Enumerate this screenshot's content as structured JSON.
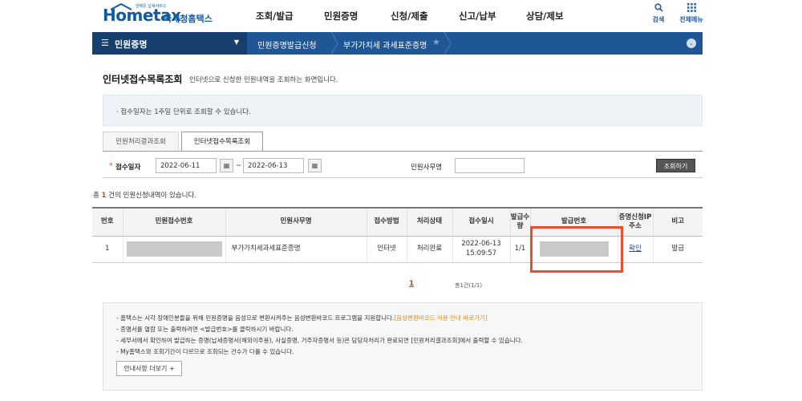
{
  "header": {
    "logo_text": "Hometax",
    "logo_tagline": "언제든 납세서비스",
    "logo_kr": "국세청홈택스",
    "menu": [
      "조회/발급",
      "민원증명",
      "신청/제출",
      "신고/납부",
      "상담/제보"
    ],
    "search_label": "검색",
    "all_menu_label": "전체메뉴"
  },
  "navbar": {
    "menu_label": "민원증명",
    "crumb1": "민원증명발급신청",
    "crumb2": "부가가치세 과세표준증명"
  },
  "page": {
    "title": "인터넷접수목록조회",
    "description": "인터넷으로 신청한 민원내역을 조회하는 화면입니다."
  },
  "notice_top": "접수일자는 1주일 단위로 조회할 수 있습니다.",
  "tabs": [
    "민원처리결과조회",
    "인터넷접수목록조회"
  ],
  "search": {
    "date_label": "접수일자",
    "date_from": "2022-06-11",
    "date_to": "2022-06-13",
    "tilde": "~",
    "work_label": "민원사무명",
    "work_value": "",
    "search_button": "조회하기"
  },
  "count": {
    "prefix": "총 ",
    "num": "1",
    "suffix": " 건의 민원신청내역이 있습니다."
  },
  "table": {
    "headers": [
      "번호",
      "민원접수번호",
      "민원사무명",
      "접수방법",
      "처리상태",
      "접수일시",
      "발급수량",
      "발급번호",
      "증명신청IP주소",
      "비고"
    ],
    "rows": [
      {
        "no": "1",
        "work": "부가가치세과세표준증명",
        "method": "인터넷",
        "status": "처리완료",
        "date": "2022-06-13",
        "time": "15:09:57",
        "qty": "1/1",
        "ip": "확인",
        "note": "발급"
      }
    ]
  },
  "pagination": {
    "current": "1",
    "info": "총1건(1/1)"
  },
  "notice_bottom": {
    "line1": "- 홈택스는 시각 장애인분들을 위해 민원증명을 음성으로 변환시켜주는 음성변환바코드 프로그램을 지원합니다.",
    "line1_link": "[음성변환바코드 이용 안내 바로가기]",
    "line2": "- 증명서를 열람 또는 출력하려면 <발급번호>를 클릭하시기 바랍니다.",
    "line3": "- 세무서에서 확인하여 발급하는 증명(납세증명서(해외이주용), 사실증명, 거주자증명서 등)은 담당자처리가 완료되면 [민원처리결과조회]에서 출력할 수 있습니다.",
    "line4": "- My홈택스와 조회기간이 다르므로 조회되는 건수가 다를 수 있습니다.",
    "more_button": "안내사항 더보기 +"
  },
  "colors": {
    "brand_blue": "#1f5796",
    "dark_blue": "#163f6d",
    "accent_red": "#d23b2b",
    "highlight_orange": "#f04b2c",
    "link_orange": "#e38a12"
  }
}
